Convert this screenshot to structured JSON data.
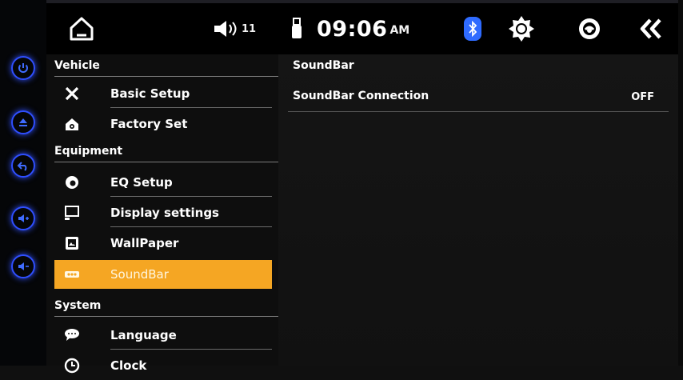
{
  "status_bar": {
    "volume_level": "11",
    "time": "09:06",
    "ampm": "AM",
    "icons": [
      "home-icon",
      "speaker-icon",
      "usb-icon",
      "bluetooth-icon",
      "brightness-icon",
      "steering-wheel-icon",
      "double-chevron-left-icon"
    ],
    "colors": {
      "bluetooth": "#2f6bff",
      "accent": "#f5a623"
    }
  },
  "hardware_buttons": [
    "power-icon",
    "eject-icon",
    "back-icon",
    "volume-up-icon",
    "volume-down-icon"
  ],
  "menu": {
    "sections": {
      "vehicle": "Vehicle",
      "equipment": "Equipment",
      "system": "System"
    },
    "items": {
      "basic_setup": "Basic Setup",
      "factory_set": "Factory Set",
      "eq_setup": "EQ Setup",
      "display_settings": "Display settings",
      "wallpaper": "WallPaper",
      "soundbar": "SoundBar",
      "language": "Language",
      "clock": "Clock"
    },
    "active_item": "SoundBar"
  },
  "panel": {
    "title": "SoundBar",
    "rows": [
      {
        "label": "SoundBar Connection",
        "value": "OFF"
      }
    ]
  }
}
